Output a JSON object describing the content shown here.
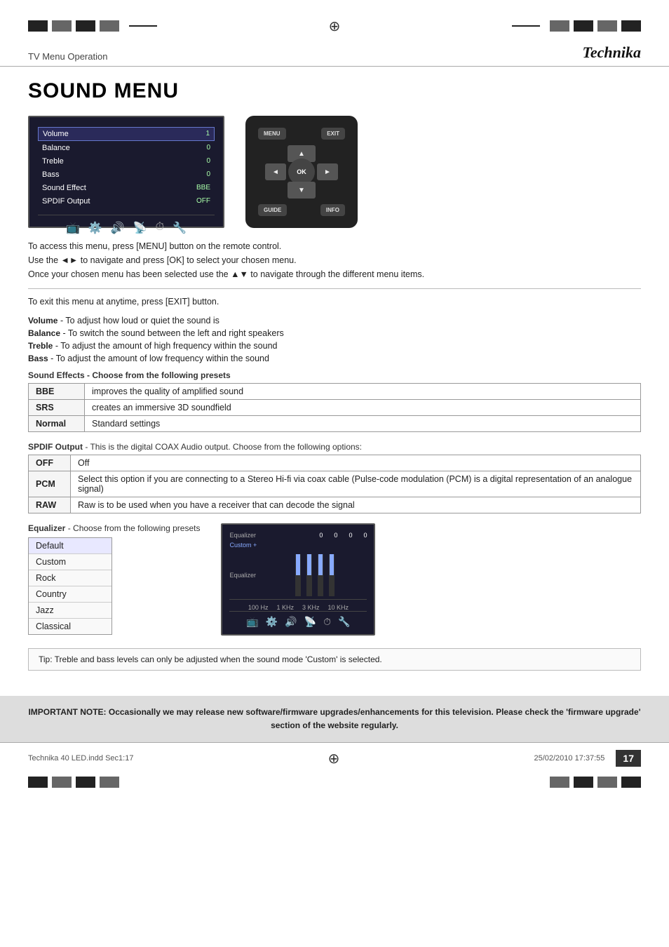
{
  "header": {
    "subtitle": "TV Menu Operation",
    "brand": "Technika"
  },
  "page_title": "SOUND MENU",
  "tv_menu": {
    "items": [
      {
        "label": "Volume",
        "value": "1"
      },
      {
        "label": "Balance",
        "value": "0"
      },
      {
        "label": "Treble",
        "value": "0"
      },
      {
        "label": "Bass",
        "value": "0"
      },
      {
        "label": "Sound Effect",
        "value": "BBE"
      },
      {
        "label": "SPDIF Output",
        "value": "OFF"
      }
    ]
  },
  "instructions": {
    "line1": "To access this menu, press [MENU] button on the remote control.",
    "line2": "Use the ◄► to navigate and press [OK] to select your chosen menu.",
    "line3": "Once your chosen menu has been selected use the ▲▼ to navigate through the different menu items.",
    "line4": "To exit this menu at anytime, press [EXIT] button."
  },
  "features": [
    {
      "label": "Volume",
      "desc": "To adjust how loud or quiet the sound is"
    },
    {
      "label": "Balance",
      "desc": "To switch the sound between the left and right speakers"
    },
    {
      "label": "Treble",
      "desc": "To adjust the amount of high frequency within the sound"
    },
    {
      "label": "Bass",
      "desc": "To adjust the amount of low frequency within the sound"
    }
  ],
  "sound_effects": {
    "header": "Sound Effects - Choose from the following presets",
    "rows": [
      {
        "option": "BBE",
        "desc": "improves the quality of amplified sound"
      },
      {
        "option": "SRS",
        "desc": "creates an immersive 3D soundfield"
      },
      {
        "option": "Normal",
        "desc": "Standard settings"
      }
    ]
  },
  "spdif": {
    "header": "SPDIF Output - This is the digital COAX Audio output. Choose from the following options:",
    "rows": [
      {
        "option": "OFF",
        "desc": "Off"
      },
      {
        "option": "PCM",
        "desc": "Select this option if you are connecting to a Stereo Hi-fi via coax cable (Pulse-code modulation (PCM) is a digital representation of an analogue signal)"
      },
      {
        "option": "RAW",
        "desc": "Raw is to be used when you have a receiver that can decode the signal"
      }
    ]
  },
  "equalizer": {
    "header": "Equalizer- Choose from the following presets",
    "items": [
      "Default",
      "Custom",
      "Rock",
      "Country",
      "Jazz",
      "Classical"
    ],
    "bars": [
      {
        "freq": "100 Hz",
        "value": 0
      },
      {
        "freq": "1 KHz",
        "value": 0
      },
      {
        "freq": "3 KHz",
        "value": 0
      },
      {
        "freq": "10 KHz",
        "value": 0
      }
    ]
  },
  "tip": {
    "text": "Tip: Treble and bass levels can only be adjusted when the sound mode 'Custom' is selected."
  },
  "important_note": {
    "text": "IMPORTANT NOTE: Occasionally we may release new software/firmware upgrades/enhancements for this television. Please check the 'firmware upgrade' section of the website regularly."
  },
  "footer": {
    "file": "Technika 40 LED.indd  Sec1:17",
    "date": "25/02/2010  17:37:55",
    "page_number": "17"
  },
  "remote": {
    "menu_label": "MENU",
    "exit_label": "EXIT",
    "ok_label": "OK",
    "guide_label": "GUIDE",
    "info_label": "INFO"
  }
}
